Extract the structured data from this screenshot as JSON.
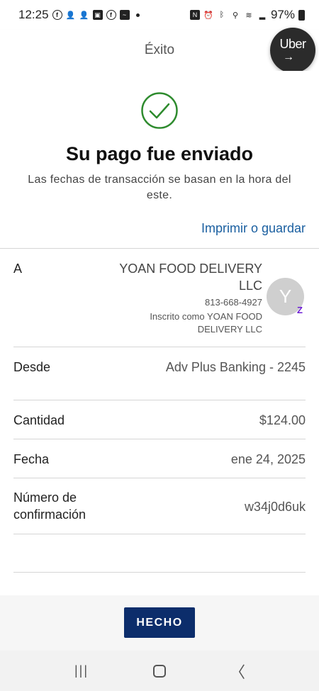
{
  "status_bar": {
    "time": "12:25",
    "battery": "97%"
  },
  "header": {
    "title": "Éxito",
    "badge_text": "Uber",
    "badge_arrow": "→"
  },
  "confirmation": {
    "title": "Su pago fue enviado",
    "subtitle": "Las fechas de transacción se basan en la hora del este.",
    "print_link": "Imprimir o guardar"
  },
  "details": {
    "to": {
      "label": "A",
      "name": "YOAN FOOD DELIVERY LLC",
      "phone": "813-668-4927",
      "enrolled": "Inscrito como YOAN FOOD DELIVERY LLC",
      "avatar_letter": "Y",
      "zelle_glyph": "Z"
    },
    "from": {
      "label": "Desde",
      "value": "Adv Plus Banking - 2245"
    },
    "amount": {
      "label": "Cantidad",
      "value": "$124.00"
    },
    "date": {
      "label": "Fecha",
      "value": "ene 24, 2025"
    },
    "confirmation_number": {
      "label": "Número de confirmación",
      "value": "w34j0d6uk"
    }
  },
  "actions": {
    "done_label": "HECHO"
  },
  "nav": {
    "recents_glyph": "|||",
    "home_glyph": "▢",
    "back_glyph": "〈"
  },
  "colors": {
    "accent_green": "#2e8b2e",
    "link_blue": "#1a5fa0",
    "button_navy": "#0c2d6b",
    "zelle_purple": "#6d1ed4"
  }
}
